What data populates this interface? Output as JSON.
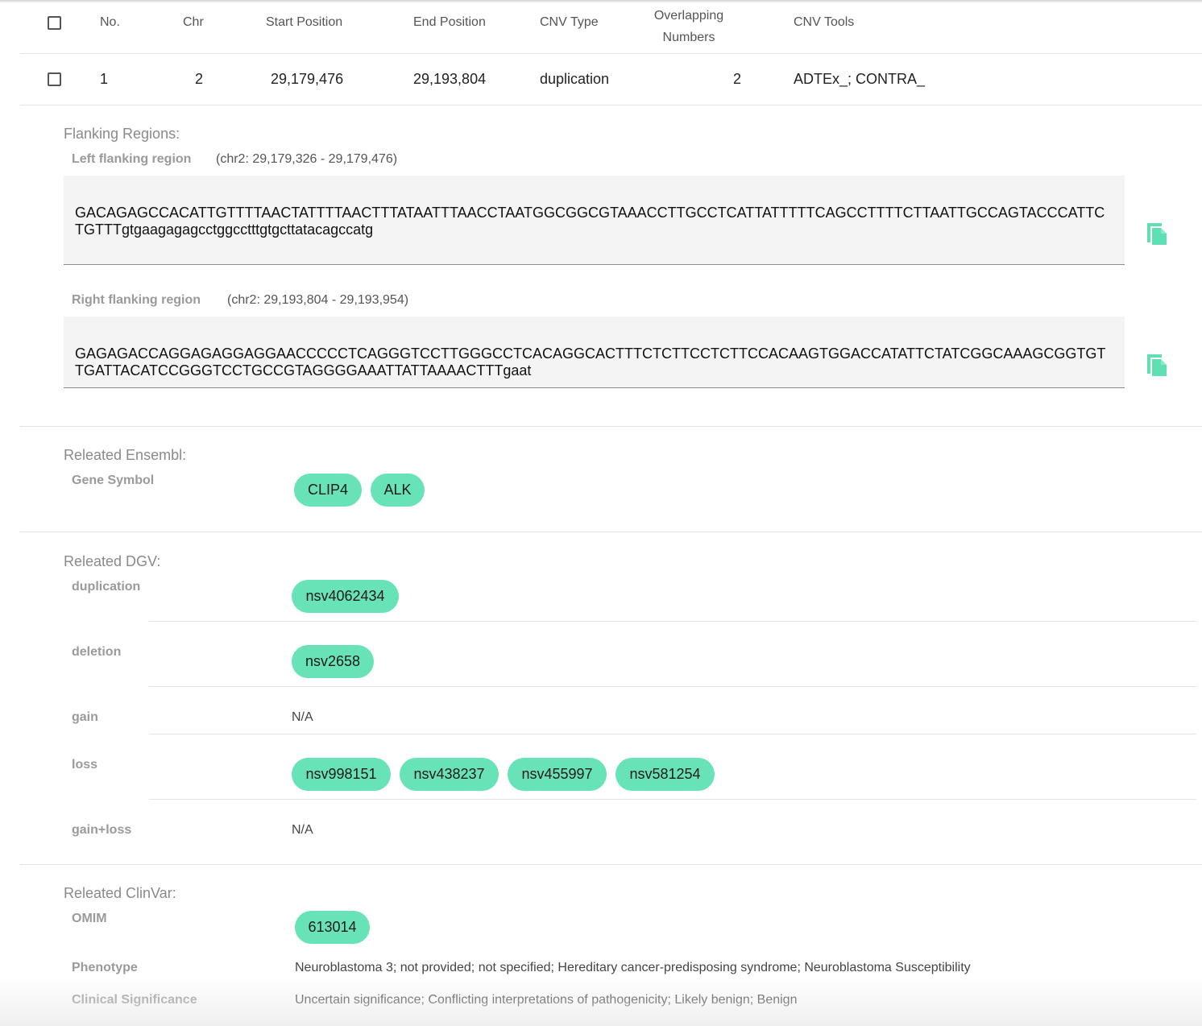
{
  "table": {
    "headers": {
      "no": "No.",
      "chr": "Chr",
      "start": "Start Position",
      "end": "End Position",
      "type": "CNV Type",
      "overlap_line1": "Overlapping",
      "overlap_line2": "Numbers",
      "tools": "CNV Tools"
    },
    "row": {
      "no": "1",
      "chr": "2",
      "start": "29,179,476",
      "end": "29,193,804",
      "type": "duplication",
      "overlap": "2",
      "tools": "ADTEx_; CONTRA_"
    }
  },
  "flanking": {
    "title": "Flanking Regions:",
    "left": {
      "label": "Left flanking region",
      "coords": "(chr2: 29,179,326 - 29,179,476)",
      "sequence": "GACAGAGCCACATTGTTTTAACTATTTTAACTTTATAATTTAACCTAATGGCGGCGTAAACCTTGCCTCATTATTTTTCAGCCTTTTCTTAATTGCCAGTACCCATTCTGTTTgtgaagagagcctggcctttgtgcttatacagccatg"
    },
    "right": {
      "label": "Right flanking region",
      "coords": "(chr2: 29,193,804 - 29,193,954)",
      "sequence": "GAGAGACCAGGAGAGGAGGAACCCCCTCAGGGTCCTTGGGCCTCACAGGCACTTTCTCTTCCTCTTCCACAAGTGGACCATATTCTATCGGCAAAGCGGTGTTGATTACATCCGGGTCCTGCCGTAGGGGAAATTATTAAAACTTTgaat"
    },
    "copy_icon": "copy-icon"
  },
  "ensembl": {
    "title": "Releated Ensembl:",
    "gene_label": "Gene Symbol",
    "genes": [
      "CLIP4",
      "ALK"
    ]
  },
  "dgv": {
    "title": "Releated DGV:",
    "rows": [
      {
        "label": "duplication",
        "chips": [
          "nsv4062434"
        ],
        "value": ""
      },
      {
        "label": "deletion",
        "chips": [
          "nsv2658"
        ],
        "value": ""
      },
      {
        "label": "gain",
        "chips": [],
        "value": "N/A"
      },
      {
        "label": "loss",
        "chips": [
          "nsv998151",
          "nsv438237",
          "nsv455997",
          "nsv581254"
        ],
        "value": ""
      },
      {
        "label": "gain+loss",
        "chips": [],
        "value": "N/A"
      }
    ]
  },
  "clinvar": {
    "title": "Releated ClinVar:",
    "omim_label": "OMIM",
    "omim": [
      "613014"
    ],
    "phenotype_label": "Phenotype",
    "phenotype": "Neuroblastoma 3; not provided; not specified; Hereditary cancer-predisposing syndrome; Neuroblastoma Susceptibility",
    "significance_label": "Clinical Significance",
    "significance": "Uncertain significance; Conflicting interpretations of pathogenicity; Likely benign; Benign"
  },
  "colors": {
    "chip": "#67e3b7",
    "copy_icon": "#5fe0b2"
  }
}
